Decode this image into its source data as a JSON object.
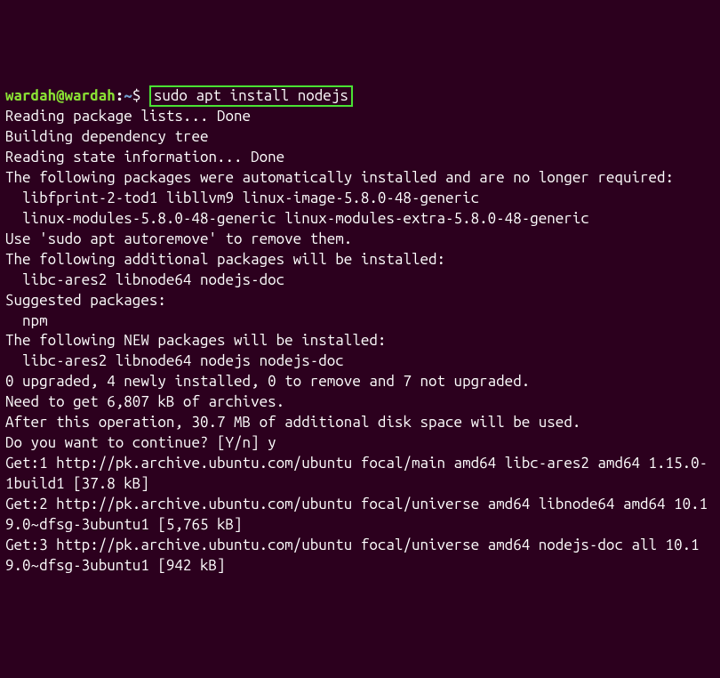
{
  "prompt": {
    "user_host": "wardah@wardah",
    "colon": ":",
    "path": "~",
    "dollar": "$ "
  },
  "command": "sudo apt install nodejs",
  "lines": {
    "l1": "Reading package lists... Done",
    "l2": "Building dependency tree",
    "l3": "Reading state information... Done",
    "l4": "The following packages were automatically installed and are no longer required:",
    "l5": "libfprint-2-tod1 libllvm9 linux-image-5.8.0-48-generic",
    "l6": "linux-modules-5.8.0-48-generic linux-modules-extra-5.8.0-48-generic",
    "l7": "Use 'sudo apt autoremove' to remove them.",
    "l8": "The following additional packages will be installed:",
    "l9": "libc-ares2 libnode64 nodejs-doc",
    "l10": "Suggested packages:",
    "l11": "npm",
    "l12": "The following NEW packages will be installed:",
    "l13": "libc-ares2 libnode64 nodejs nodejs-doc",
    "l14": "0 upgraded, 4 newly installed, 0 to remove and 7 not upgraded.",
    "l15": "Need to get 6,807 kB of archives.",
    "l16": "After this operation, 30.7 MB of additional disk space will be used.",
    "l17": "Do you want to continue? [Y/n] y",
    "l18": "Get:1 http://pk.archive.ubuntu.com/ubuntu focal/main amd64 libc-ares2 amd64 1.15.0-1build1 [37.8 kB]",
    "l19": "Get:2 http://pk.archive.ubuntu.com/ubuntu focal/universe amd64 libnode64 amd64 10.19.0~dfsg-3ubuntu1 [5,765 kB]",
    "l20": "Get:3 http://pk.archive.ubuntu.com/ubuntu focal/universe amd64 nodejs-doc all 10.19.0~dfsg-3ubuntu1 [942 kB]"
  }
}
